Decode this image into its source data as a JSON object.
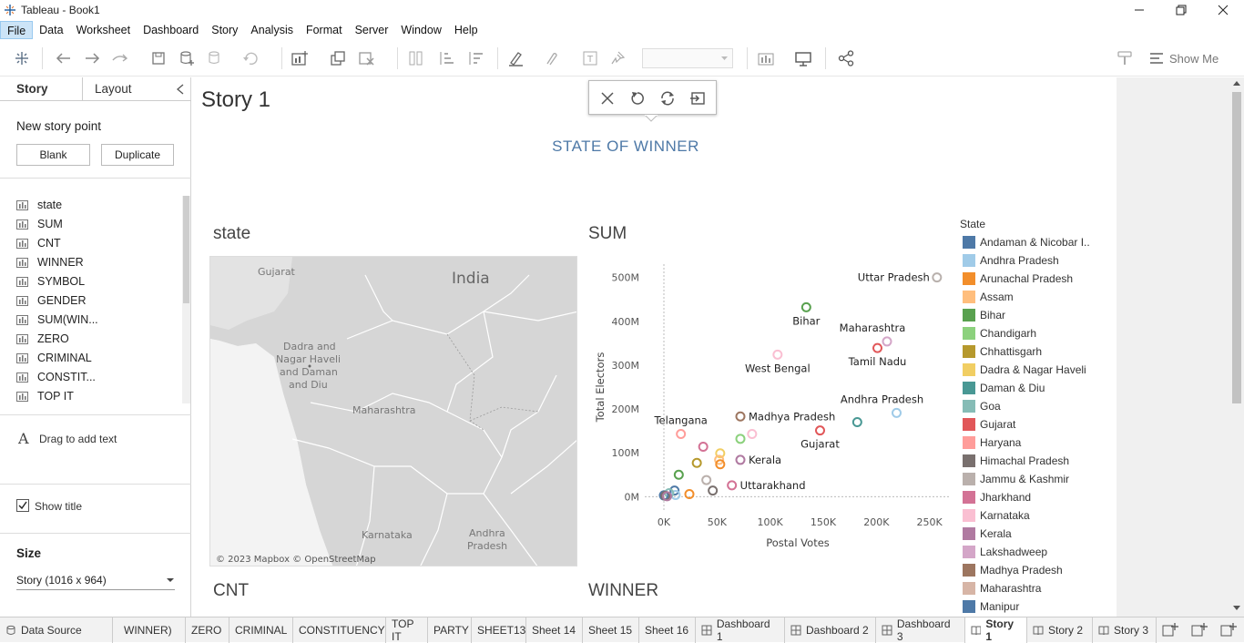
{
  "window": {
    "title": "Tableau - Book1"
  },
  "menu": [
    "File",
    "Data",
    "Worksheet",
    "Dashboard",
    "Story",
    "Analysis",
    "Format",
    "Server",
    "Window",
    "Help"
  ],
  "toolbar": {
    "show_me": "Show Me"
  },
  "left_panel": {
    "tab_story": "Story",
    "tab_layout": "Layout",
    "new_story_point": "New story point",
    "blank": "Blank",
    "duplicate": "Duplicate",
    "sheets": [
      "state",
      "SUM",
      "CNT",
      "WINNER",
      "SYMBOL",
      "GENDER",
      "SUM(WIN...",
      "ZERO",
      "CRIMINAL",
      "CONSTIT...",
      "TOP IT"
    ],
    "drag_text": "Drag to add text",
    "show_title": "Show title",
    "size_heading": "Size",
    "size_value": "Story (1016 x 964)"
  },
  "story": {
    "title": "Story 1",
    "dashboard_title": "STATE OF WINNER",
    "sheet_state": "state",
    "sheet_sum": "SUM",
    "sheet_cnt": "CNT",
    "sheet_winner": "WINNER"
  },
  "map": {
    "labels": [
      "India",
      "Gujarat",
      "Dadra and",
      "Nagar Haveli",
      "and Daman",
      "and Diu",
      "Maharashtra",
      "Karnataka",
      "Andhra",
      "Pradesh"
    ],
    "copyright": "© 2023 Mapbox © OpenStreetMap"
  },
  "chart_data": {
    "type": "scatter",
    "xlabel": "Postal Votes",
    "ylabel": "Total Electors",
    "xlim": [
      -18000,
      270000
    ],
    "ylim": [
      -20000000,
      520000000
    ],
    "x_ticks": [
      {
        "v": 0,
        "t": "0K"
      },
      {
        "v": 50000,
        "t": "50K"
      },
      {
        "v": 100000,
        "t": "100K"
      },
      {
        "v": 150000,
        "t": "150K"
      },
      {
        "v": 200000,
        "t": "200K"
      },
      {
        "v": 250000,
        "t": "250K"
      }
    ],
    "y_ticks": [
      {
        "v": 0,
        "t": "0M"
      },
      {
        "v": 100000000,
        "t": "100M"
      },
      {
        "v": 200000000,
        "t": "200M"
      },
      {
        "v": 300000000,
        "t": "300M"
      },
      {
        "v": 400000000,
        "t": "400M"
      },
      {
        "v": 500000000,
        "t": "500M"
      }
    ],
    "points": [
      {
        "x": 257000,
        "y": 500000000,
        "color": "#b8b0ac",
        "label": "Uttar Pradesh",
        "lpos": "left"
      },
      {
        "x": 134000,
        "y": 432000000,
        "color": "#59a14f",
        "label": "Bihar",
        "lpos": "below"
      },
      {
        "x": 210000,
        "y": 354000000,
        "color": "#d4a6c8",
        "label": "Maharashtra",
        "lpos": "aboveleft"
      },
      {
        "x": 201000,
        "y": 339000000,
        "color": "#e15759",
        "label": "Tamil Nadu",
        "lpos": "below"
      },
      {
        "x": 107000,
        "y": 324000000,
        "color": "#fabfd2",
        "label": "West Bengal",
        "lpos": "below"
      },
      {
        "x": 219000,
        "y": 191000000,
        "color": "#a0cbe8",
        "label": "Andhra Pradesh",
        "lpos": "aboveleft"
      },
      {
        "x": 182000,
        "y": 170000000,
        "color": "#499894",
        "label": "",
        "lpos": ""
      },
      {
        "x": 72000,
        "y": 183000000,
        "color": "#9d7660",
        "label": "Madhya Pradesh",
        "lpos": "right"
      },
      {
        "x": 147000,
        "y": 151000000,
        "color": "#e15759",
        "label": "Gujarat",
        "lpos": "below"
      },
      {
        "x": 16000,
        "y": 143000000,
        "color": "#ff9d9a",
        "label": "Telangana",
        "lpos": "above"
      },
      {
        "x": 83000,
        "y": 143000000,
        "color": "#fabfd2",
        "label": "",
        "lpos": ""
      },
      {
        "x": 72000,
        "y": 132000000,
        "color": "#8cd17d",
        "label": "",
        "lpos": ""
      },
      {
        "x": 37000,
        "y": 114000000,
        "color": "#d37295",
        "label": "",
        "lpos": ""
      },
      {
        "x": 53000,
        "y": 99000000,
        "color": "#f1ce63",
        "label": "",
        "lpos": ""
      },
      {
        "x": 72000,
        "y": 84000000,
        "color": "#b07aa1",
        "label": "Kerala",
        "lpos": "right"
      },
      {
        "x": 52000,
        "y": 84000000,
        "color": "#ffbe7d",
        "label": "",
        "lpos": ""
      },
      {
        "x": 31000,
        "y": 77000000,
        "color": "#b6992d",
        "label": "",
        "lpos": ""
      },
      {
        "x": 53000,
        "y": 74000000,
        "color": "#f28e2b",
        "label": "",
        "lpos": ""
      },
      {
        "x": 14000,
        "y": 50000000,
        "color": "#59a14f",
        "label": "",
        "lpos": ""
      },
      {
        "x": 64000,
        "y": 26000000,
        "color": "#d37295",
        "label": "Uttarakhand",
        "lpos": "right"
      },
      {
        "x": 40000,
        "y": 38000000,
        "color": "#bab0ac",
        "label": "",
        "lpos": ""
      },
      {
        "x": 46000,
        "y": 14000000,
        "color": "#79706e",
        "label": "",
        "lpos": ""
      },
      {
        "x": 24000,
        "y": 6000000,
        "color": "#f28e2b",
        "label": "",
        "lpos": ""
      },
      {
        "x": 10000,
        "y": 14000000,
        "color": "#4e79a7",
        "label": "",
        "lpos": ""
      },
      {
        "x": 11000,
        "y": 4000000,
        "color": "#a0cbe8",
        "label": "",
        "lpos": ""
      },
      {
        "x": 5000,
        "y": 8000000,
        "color": "#86bcb6",
        "label": "",
        "lpos": ""
      },
      {
        "x": 0,
        "y": 3000000,
        "color": "#4e79a7",
        "label": "",
        "lpos": ""
      },
      {
        "x": 1500,
        "y": 2000000,
        "color": "#79706e",
        "label": "",
        "lpos": ""
      },
      {
        "x": 3000,
        "y": 1000000,
        "color": "#b07aa1",
        "label": "",
        "lpos": ""
      }
    ],
    "legend": {
      "title": "State",
      "items": [
        {
          "name": "Andaman & Nicobar I..",
          "color": "#4e79a7"
        },
        {
          "name": "Andhra Pradesh",
          "color": "#a0cbe8"
        },
        {
          "name": "Arunachal Pradesh",
          "color": "#f28e2b"
        },
        {
          "name": "Assam",
          "color": "#ffbe7d"
        },
        {
          "name": "Bihar",
          "color": "#59a14f"
        },
        {
          "name": "Chandigarh",
          "color": "#8cd17d"
        },
        {
          "name": "Chhattisgarh",
          "color": "#b6992d"
        },
        {
          "name": "Dadra & Nagar Haveli",
          "color": "#f1ce63"
        },
        {
          "name": "Daman & Diu",
          "color": "#499894"
        },
        {
          "name": "Goa",
          "color": "#86bcb6"
        },
        {
          "name": "Gujarat",
          "color": "#e15759"
        },
        {
          "name": "Haryana",
          "color": "#ff9d9a"
        },
        {
          "name": "Himachal Pradesh",
          "color": "#79706e"
        },
        {
          "name": "Jammu & Kashmir",
          "color": "#bab0ac"
        },
        {
          "name": "Jharkhand",
          "color": "#d37295"
        },
        {
          "name": "Karnataka",
          "color": "#fabfd2"
        },
        {
          "name": "Kerala",
          "color": "#b07aa1"
        },
        {
          "name": "Lakshadweep",
          "color": "#d4a6c8"
        },
        {
          "name": "Madhya Pradesh",
          "color": "#9d7660"
        },
        {
          "name": "Maharashtra",
          "color": "#d7b5a6"
        },
        {
          "name": "Manipur",
          "color": "#4e79a7"
        }
      ]
    }
  },
  "bottom_tabs": [
    {
      "label": "Data Source",
      "type": "datasource"
    },
    {
      "label": "WINNER)",
      "type": "sheet"
    },
    {
      "label": "ZERO",
      "type": "sheet"
    },
    {
      "label": "CRIMINAL",
      "type": "sheet"
    },
    {
      "label": "CONSTITUENCY",
      "type": "sheet"
    },
    {
      "label": "TOP IT",
      "type": "sheet"
    },
    {
      "label": "PARTY",
      "type": "sheet"
    },
    {
      "label": "SHEET13",
      "type": "sheet"
    },
    {
      "label": "Sheet 14",
      "type": "sheet"
    },
    {
      "label": "Sheet 15",
      "type": "sheet"
    },
    {
      "label": "Sheet 16",
      "type": "sheet"
    },
    {
      "label": "Dashboard 1",
      "type": "dashboard"
    },
    {
      "label": "Dashboard 2",
      "type": "dashboard"
    },
    {
      "label": "Dashboard 3",
      "type": "dashboard"
    },
    {
      "label": "Story 1",
      "type": "story",
      "active": true
    },
    {
      "label": "Story 2",
      "type": "story"
    },
    {
      "label": "Story 3",
      "type": "story"
    }
  ]
}
